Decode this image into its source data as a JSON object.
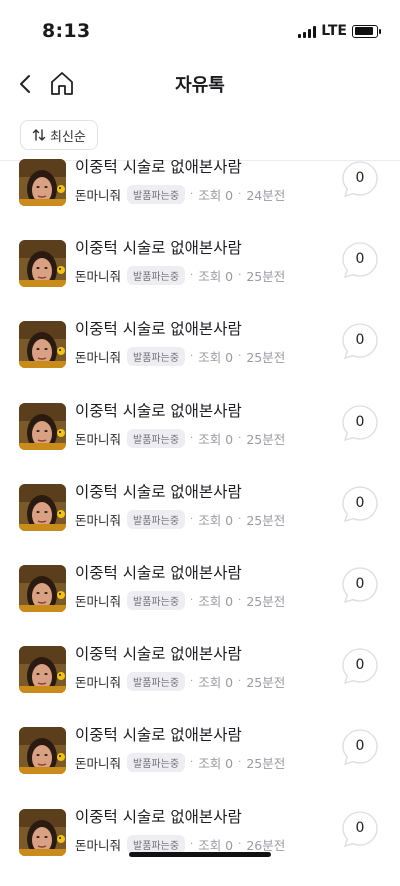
{
  "status": {
    "time": "8:13",
    "network": "LTE"
  },
  "nav": {
    "title": "자유톡"
  },
  "sort": {
    "label": "최신순"
  },
  "posts": [
    {
      "title": "이중턱 시술로 없애본사람",
      "author": "돈마니줘",
      "badge": "발품파는중",
      "views": "조회 0",
      "time": "24분전",
      "comments": "0"
    },
    {
      "title": "이중턱 시술로 없애본사람",
      "author": "돈마니줘",
      "badge": "발품파는중",
      "views": "조회 0",
      "time": "25분전",
      "comments": "0"
    },
    {
      "title": "이중턱 시술로 없애본사람",
      "author": "돈마니줘",
      "badge": "발품파는중",
      "views": "조회 0",
      "time": "25분전",
      "comments": "0"
    },
    {
      "title": "이중턱 시술로 없애본사람",
      "author": "돈마니줘",
      "badge": "발품파는중",
      "views": "조회 0",
      "time": "25분전",
      "comments": "0"
    },
    {
      "title": "이중턱 시술로 없애본사람",
      "author": "돈마니줘",
      "badge": "발품파는중",
      "views": "조회 0",
      "time": "25분전",
      "comments": "0"
    },
    {
      "title": "이중턱 시술로 없애본사람",
      "author": "돈마니줘",
      "badge": "발품파는중",
      "views": "조회 0",
      "time": "25분전",
      "comments": "0"
    },
    {
      "title": "이중턱 시술로 없애본사람",
      "author": "돈마니줘",
      "badge": "발품파는중",
      "views": "조회 0",
      "time": "25분전",
      "comments": "0"
    },
    {
      "title": "이중턱 시술로 없애본사람",
      "author": "돈마니줘",
      "badge": "발품파는중",
      "views": "조회 0",
      "time": "25분전",
      "comments": "0"
    },
    {
      "title": "이중턱 시술로 없애본사람",
      "author": "돈마니줘",
      "badge": "발품파는중",
      "views": "조회 0",
      "time": "26분전",
      "comments": "0"
    }
  ],
  "colors": {
    "accent": "#1b1b1f",
    "meta": "#9a9aa3",
    "badge_bg": "#eeeef2"
  },
  "icons": {
    "back": "chevron-left-icon",
    "home": "home-icon",
    "sort": "sort-arrows-icon",
    "comment": "speech-bubble-icon"
  }
}
